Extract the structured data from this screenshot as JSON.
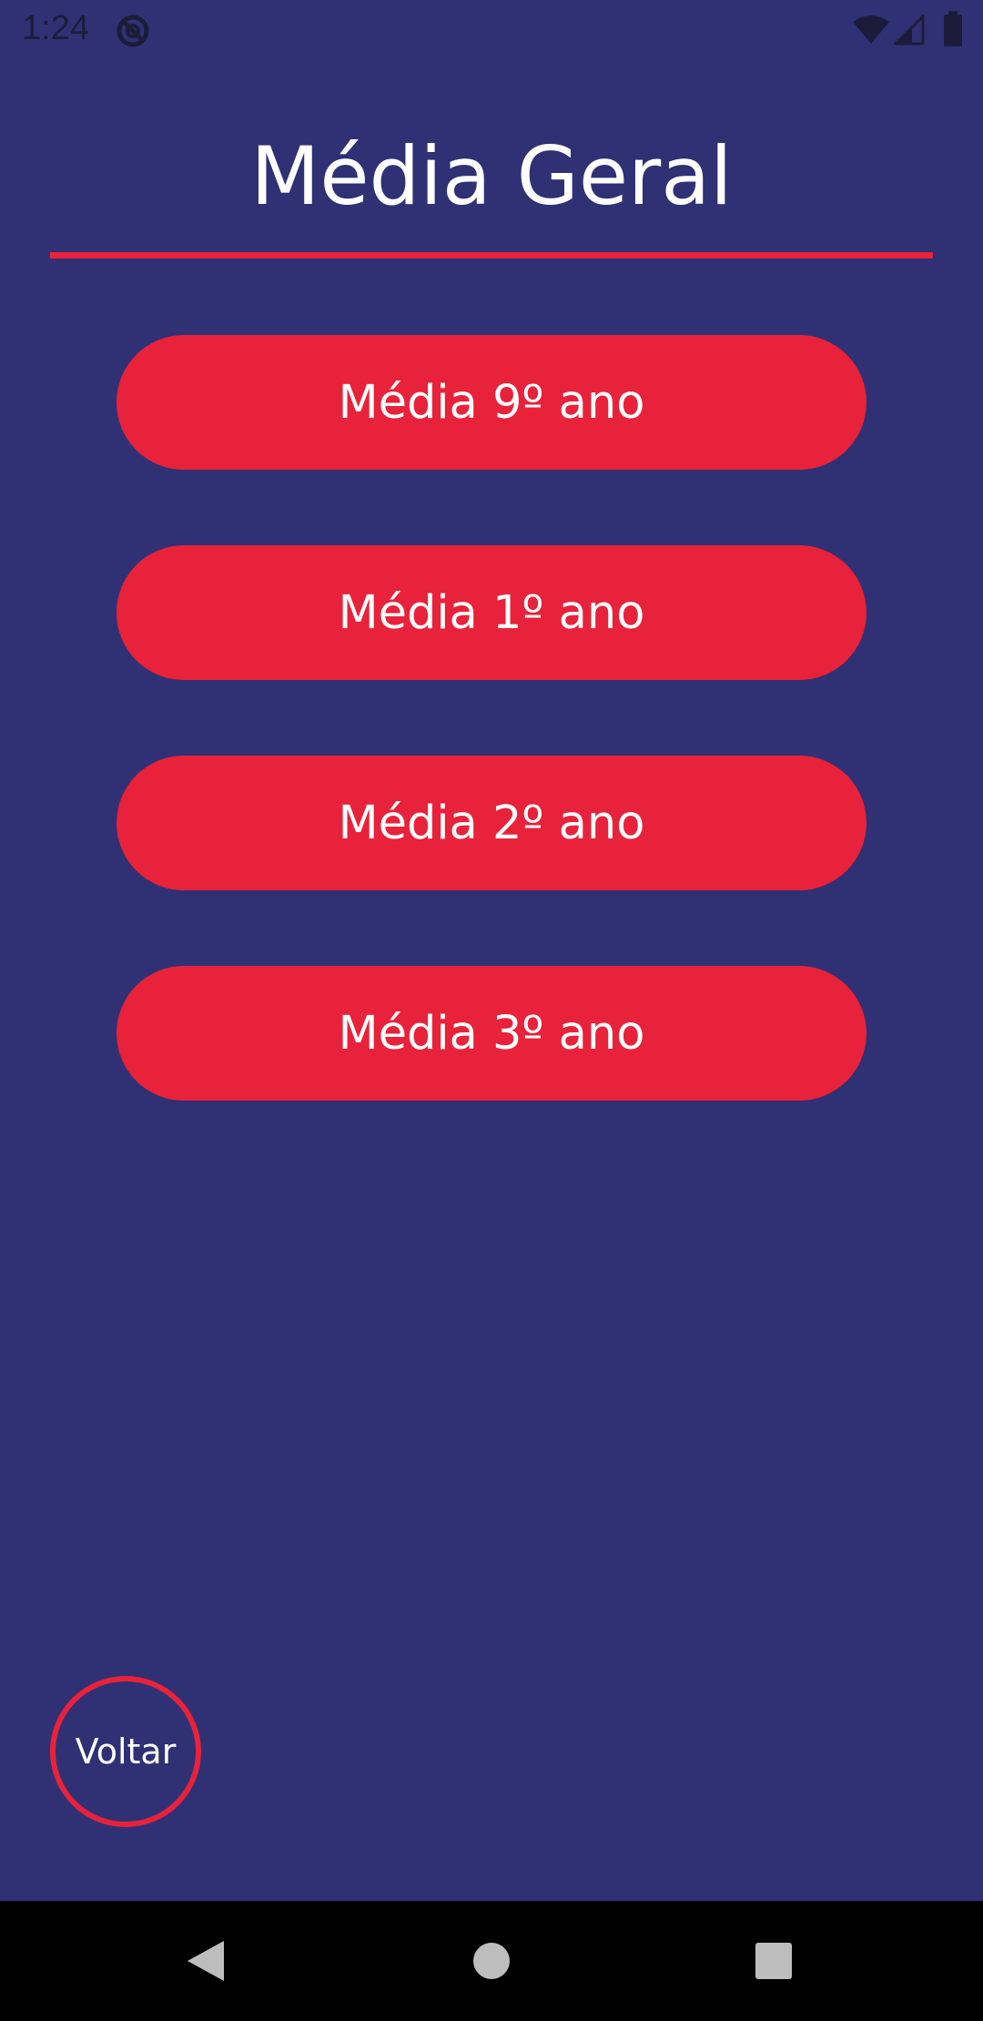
{
  "status_bar": {
    "time": "1:24",
    "icons": [
      "data-saver-icon",
      "wifi-icon",
      "signal-icon",
      "battery-icon"
    ]
  },
  "page": {
    "title": "Média Geral"
  },
  "buttons": [
    {
      "label": "Média 9º ano"
    },
    {
      "label": "Média 1º ano"
    },
    {
      "label": "Média 2º ano"
    },
    {
      "label": "Média 3º ano"
    }
  ],
  "back_button": {
    "label": "Voltar"
  },
  "nav_bar": {
    "icons": [
      "back-icon",
      "home-icon",
      "recents-icon"
    ]
  },
  "colors": {
    "background": "#2f3174",
    "accent": "#e8223a",
    "text": "#ffffff",
    "nav_bar": "#000000"
  }
}
